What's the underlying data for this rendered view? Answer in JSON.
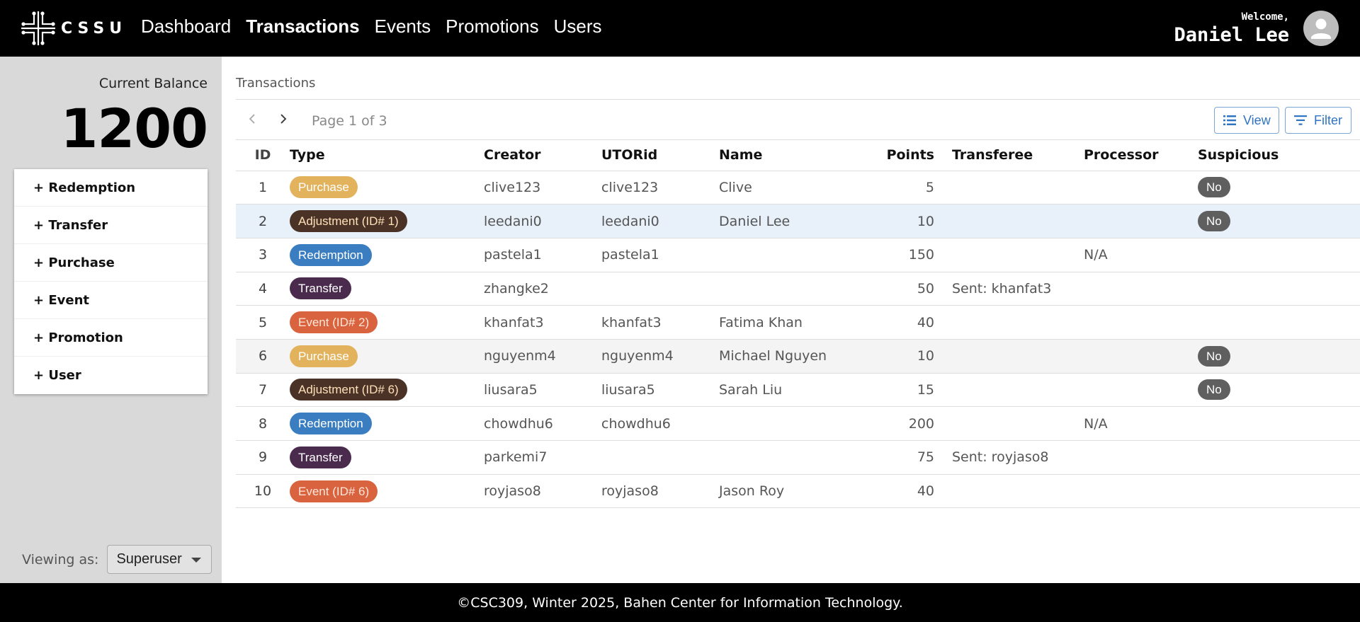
{
  "header": {
    "logo_text": "CSSU",
    "nav": [
      {
        "label": "Dashboard",
        "active": false
      },
      {
        "label": "Transactions",
        "active": true
      },
      {
        "label": "Events",
        "active": false
      },
      {
        "label": "Promotions",
        "active": false
      },
      {
        "label": "Users",
        "active": false
      }
    ],
    "welcome": "Welcome,",
    "user_name": "Daniel Lee",
    "avatar_icon": "account-circle-icon"
  },
  "sidebar": {
    "balance_label": "Current Balance",
    "balance_value": "1200",
    "actions": [
      "+ Redemption",
      "+ Transfer",
      "+ Purchase",
      "+ Event",
      "+ Promotion",
      "+ User"
    ],
    "viewing_label": "Viewing as:",
    "role": "Superuser"
  },
  "main": {
    "breadcrumb": "Transactions",
    "prev_icon": "chevron-left-icon",
    "next_icon": "chevron-right-icon",
    "page_text": "Page 1 of 3",
    "view_label": "View",
    "filter_label": "Filter",
    "columns": [
      "ID",
      "Type",
      "Creator",
      "UTORid",
      "Name",
      "Points",
      "Transferee",
      "Processor",
      "Suspicious"
    ],
    "rows": [
      {
        "id": "1",
        "type": "Purchase",
        "kind": "purchase",
        "creator": "clive123",
        "utorid": "clive123",
        "name": "Clive",
        "points": "5",
        "transferee": "",
        "processor": "",
        "suspicious": "No"
      },
      {
        "id": "2",
        "type": "Adjustment (ID# 1)",
        "kind": "adjustment",
        "creator": "leedani0",
        "utorid": "leedani0",
        "name": "Daniel Lee",
        "points": "10",
        "transferee": "",
        "processor": "",
        "suspicious": "No"
      },
      {
        "id": "3",
        "type": "Redemption",
        "kind": "redemption",
        "creator": "pastela1",
        "utorid": "pastela1",
        "name": "",
        "points": "150",
        "transferee": "",
        "processor": "N/A",
        "suspicious": ""
      },
      {
        "id": "4",
        "type": "Transfer",
        "kind": "transfer",
        "creator": "zhangke2",
        "utorid": "",
        "name": "",
        "points": "50",
        "transferee": "Sent: khanfat3",
        "processor": "",
        "suspicious": ""
      },
      {
        "id": "5",
        "type": "Event (ID# 2)",
        "kind": "event",
        "creator": "khanfat3",
        "utorid": "khanfat3",
        "name": "Fatima Khan",
        "points": "40",
        "transferee": "",
        "processor": "",
        "suspicious": ""
      },
      {
        "id": "6",
        "type": "Purchase",
        "kind": "purchase",
        "creator": "nguyenm4",
        "utorid": "nguyenm4",
        "name": "Michael Nguyen",
        "points": "10",
        "transferee": "",
        "processor": "",
        "suspicious": "No"
      },
      {
        "id": "7",
        "type": "Adjustment (ID# 6)",
        "kind": "adjustment",
        "creator": "liusara5",
        "utorid": "liusara5",
        "name": "Sarah Liu",
        "points": "15",
        "transferee": "",
        "processor": "",
        "suspicious": "No"
      },
      {
        "id": "8",
        "type": "Redemption",
        "kind": "redemption",
        "creator": "chowdhu6",
        "utorid": "chowdhu6",
        "name": "",
        "points": "200",
        "transferee": "",
        "processor": "N/A",
        "suspicious": ""
      },
      {
        "id": "9",
        "type": "Transfer",
        "kind": "transfer",
        "creator": "parkemi7",
        "utorid": "",
        "name": "",
        "points": "75",
        "transferee": "Sent: royjaso8",
        "processor": "",
        "suspicious": ""
      },
      {
        "id": "10",
        "type": "Event (ID# 6)",
        "kind": "event",
        "creator": "royjaso8",
        "utorid": "royjaso8",
        "name": "Jason Roy",
        "points": "40",
        "transferee": "",
        "processor": "",
        "suspicious": ""
      }
    ],
    "chip_colors": {
      "purchase": {
        "bg": "#e2b35c",
        "fg": "#ffffff"
      },
      "adjustment": {
        "bg": "#4a3326",
        "fg": "#ffe0b8"
      },
      "redemption": {
        "bg": "#3a7ec1",
        "fg": "#ffffff"
      },
      "transfer": {
        "bg": "#4a2b4e",
        "fg": "#ffffff"
      },
      "event": {
        "bg": "#d9633e",
        "fg": "#ffe7d9"
      }
    }
  },
  "footer": {
    "text": "©CSC309, Winter 2025, Bahen Center for Information Technology."
  }
}
